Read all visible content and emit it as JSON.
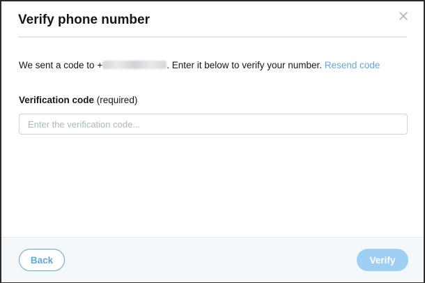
{
  "dialog": {
    "title": "Verify phone number",
    "close_icon": "close-icon"
  },
  "message": {
    "prefix": "We sent a code to +",
    "suffix": ". Enter it below to verify your number. ",
    "resend_link": "Resend code"
  },
  "field": {
    "label": "Verification code",
    "required_note": " (required)",
    "placeholder": "Enter the verification code...",
    "value": ""
  },
  "footer": {
    "back_label": "Back",
    "verify_label": "Verify"
  },
  "colors": {
    "accent": "#5ea9dd",
    "verify_button_disabled": "#9fd0f3",
    "footer_bg": "#f5f8fa",
    "text": "#14171a"
  }
}
